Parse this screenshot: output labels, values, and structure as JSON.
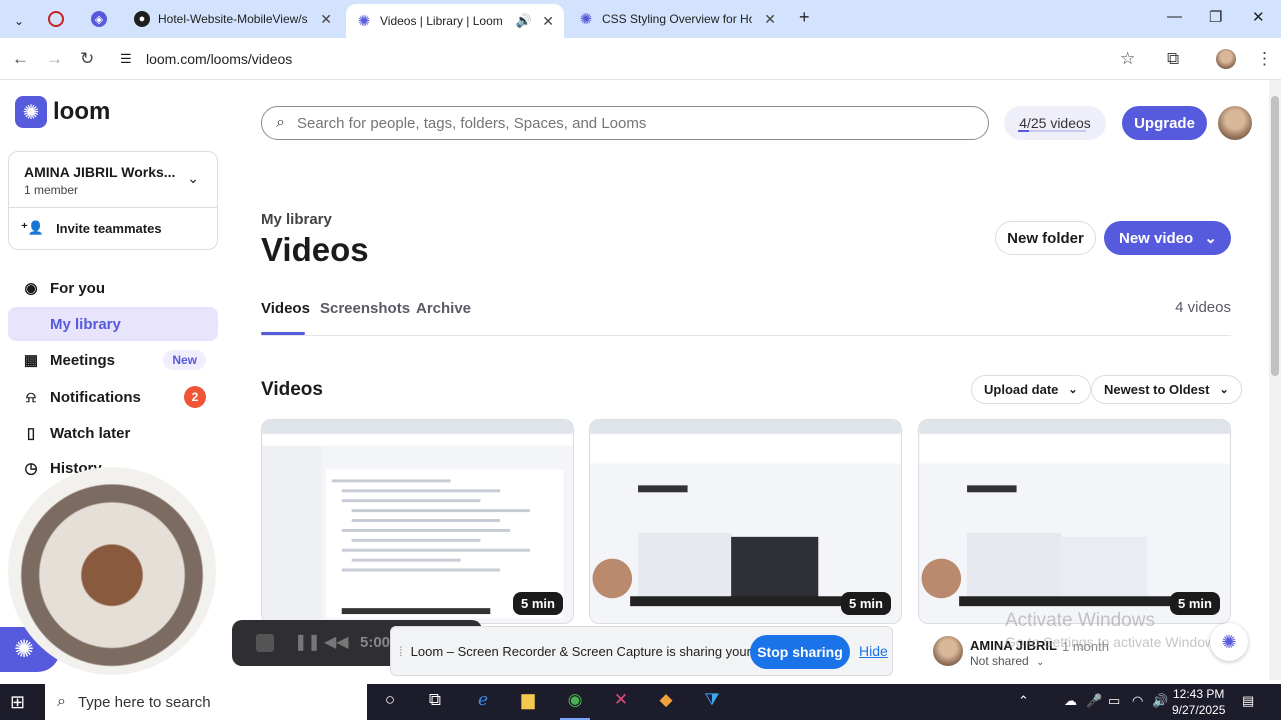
{
  "browser": {
    "tabs": [
      {
        "title": "Hotel-Website-MobileView/scr",
        "icon": "github-icon",
        "active": false
      },
      {
        "title": "Videos | Library | Loom",
        "icon": "loom-icon",
        "active": true
      },
      {
        "title": "CSS Styling Overview for Hotel",
        "icon": "chatgpt-icon",
        "active": false
      }
    ],
    "url": "loom.com/looms/videos"
  },
  "app": {
    "logo_text": "loom",
    "workspace": {
      "name": "AMINA JIBRIL Works...",
      "members": "1 member",
      "invite_label": "Invite teammates"
    },
    "sidebar": [
      {
        "label": "For you",
        "icon": "user-circle-icon"
      },
      {
        "label": "My library",
        "icon": "library-icon",
        "active": true
      },
      {
        "label": "Meetings",
        "icon": "calendar-icon",
        "badge": "New"
      },
      {
        "label": "Notifications",
        "icon": "bell-icon",
        "count": "2"
      },
      {
        "label": "Watch later",
        "icon": "bookmark-icon"
      },
      {
        "label": "History",
        "icon": "clock-icon"
      }
    ],
    "search_placeholder": "Search for people, tags, folders, Spaces, and Looms",
    "video_quota": "4/25 videos",
    "video_quota_used": 4,
    "video_quota_total": 25,
    "upgrade_label": "Upgrade",
    "breadcrumb": "My library",
    "page_title": "Videos",
    "new_folder_label": "New folder",
    "new_video_label": "New video",
    "tabs": [
      "Videos",
      "Screenshots",
      "Archive"
    ],
    "videos_count": "4 videos",
    "section_title": "Videos",
    "sort_by": "Upload date",
    "sort_order": "Newest to Oldest",
    "cards": [
      {
        "duration": "5 min"
      },
      {
        "duration": "5 min"
      },
      {
        "duration": "5 min",
        "author": "AMINA JIBRIL",
        "ago": "1 month",
        "visibility": "Not shared"
      }
    ]
  },
  "recorder": {
    "time": "5:00"
  },
  "share_banner": {
    "message": "Loom – Screen Recorder & Screen Capture is sharing your screen.",
    "stop_label": "Stop sharing",
    "hide_label": "Hide"
  },
  "watermark": {
    "line1": "Activate Windows",
    "line2": "Go to Settings to activate Windows."
  },
  "taskbar": {
    "search_placeholder": "Type here to search",
    "time": "12:43 PM",
    "date": "9/27/2025"
  }
}
